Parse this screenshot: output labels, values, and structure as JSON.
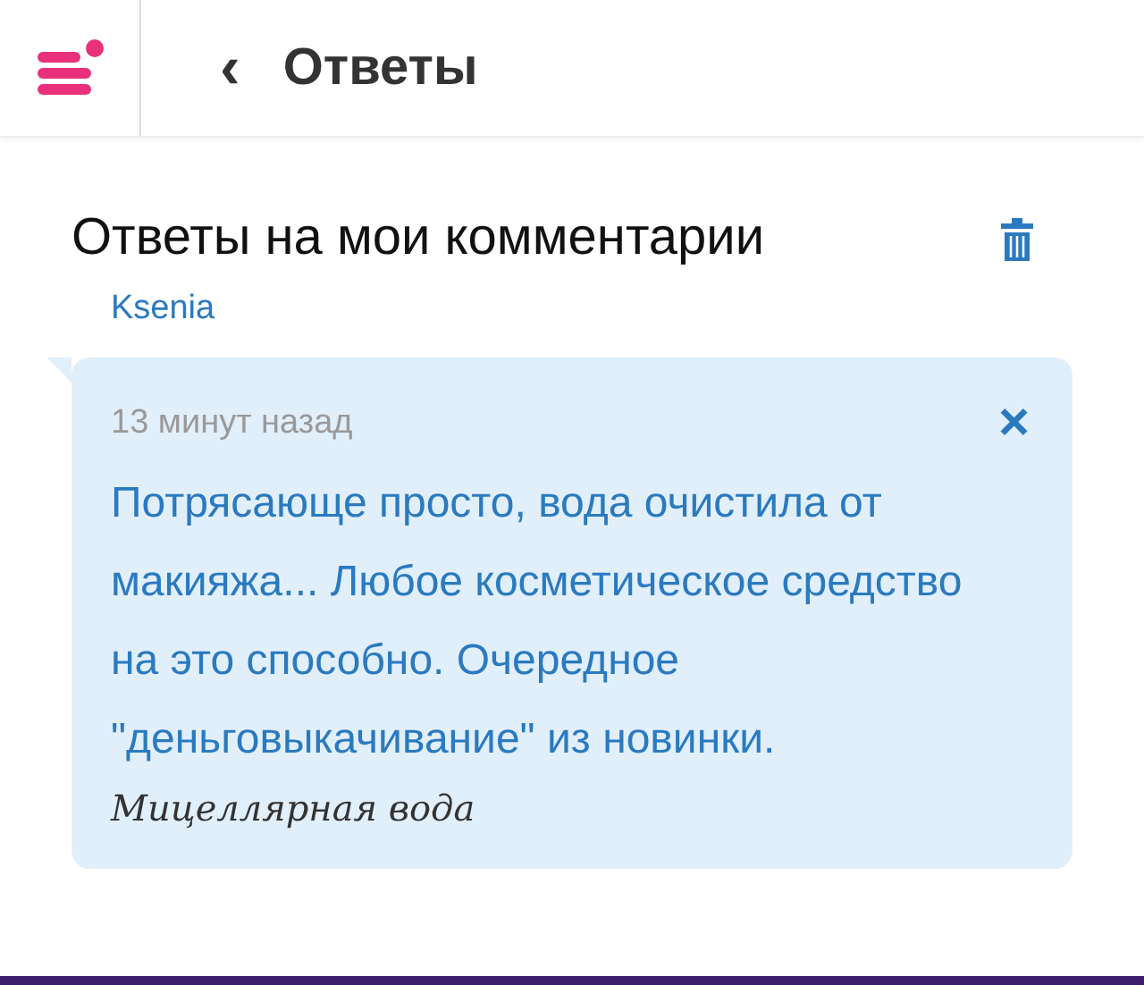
{
  "header": {
    "back": "‹",
    "title": "Ответы"
  },
  "section": {
    "title": "Ответы на мои комментарии"
  },
  "replies": [
    {
      "author": "Ksenia",
      "time": "13 минут назад",
      "close": "×",
      "text": "Потрясающе просто, вода очистила от макияжа... Любое косметическое средство на это способно. Очередное \"деньговыкачивание\" из новинки.",
      "product": "Мицеллярная вода"
    }
  ]
}
